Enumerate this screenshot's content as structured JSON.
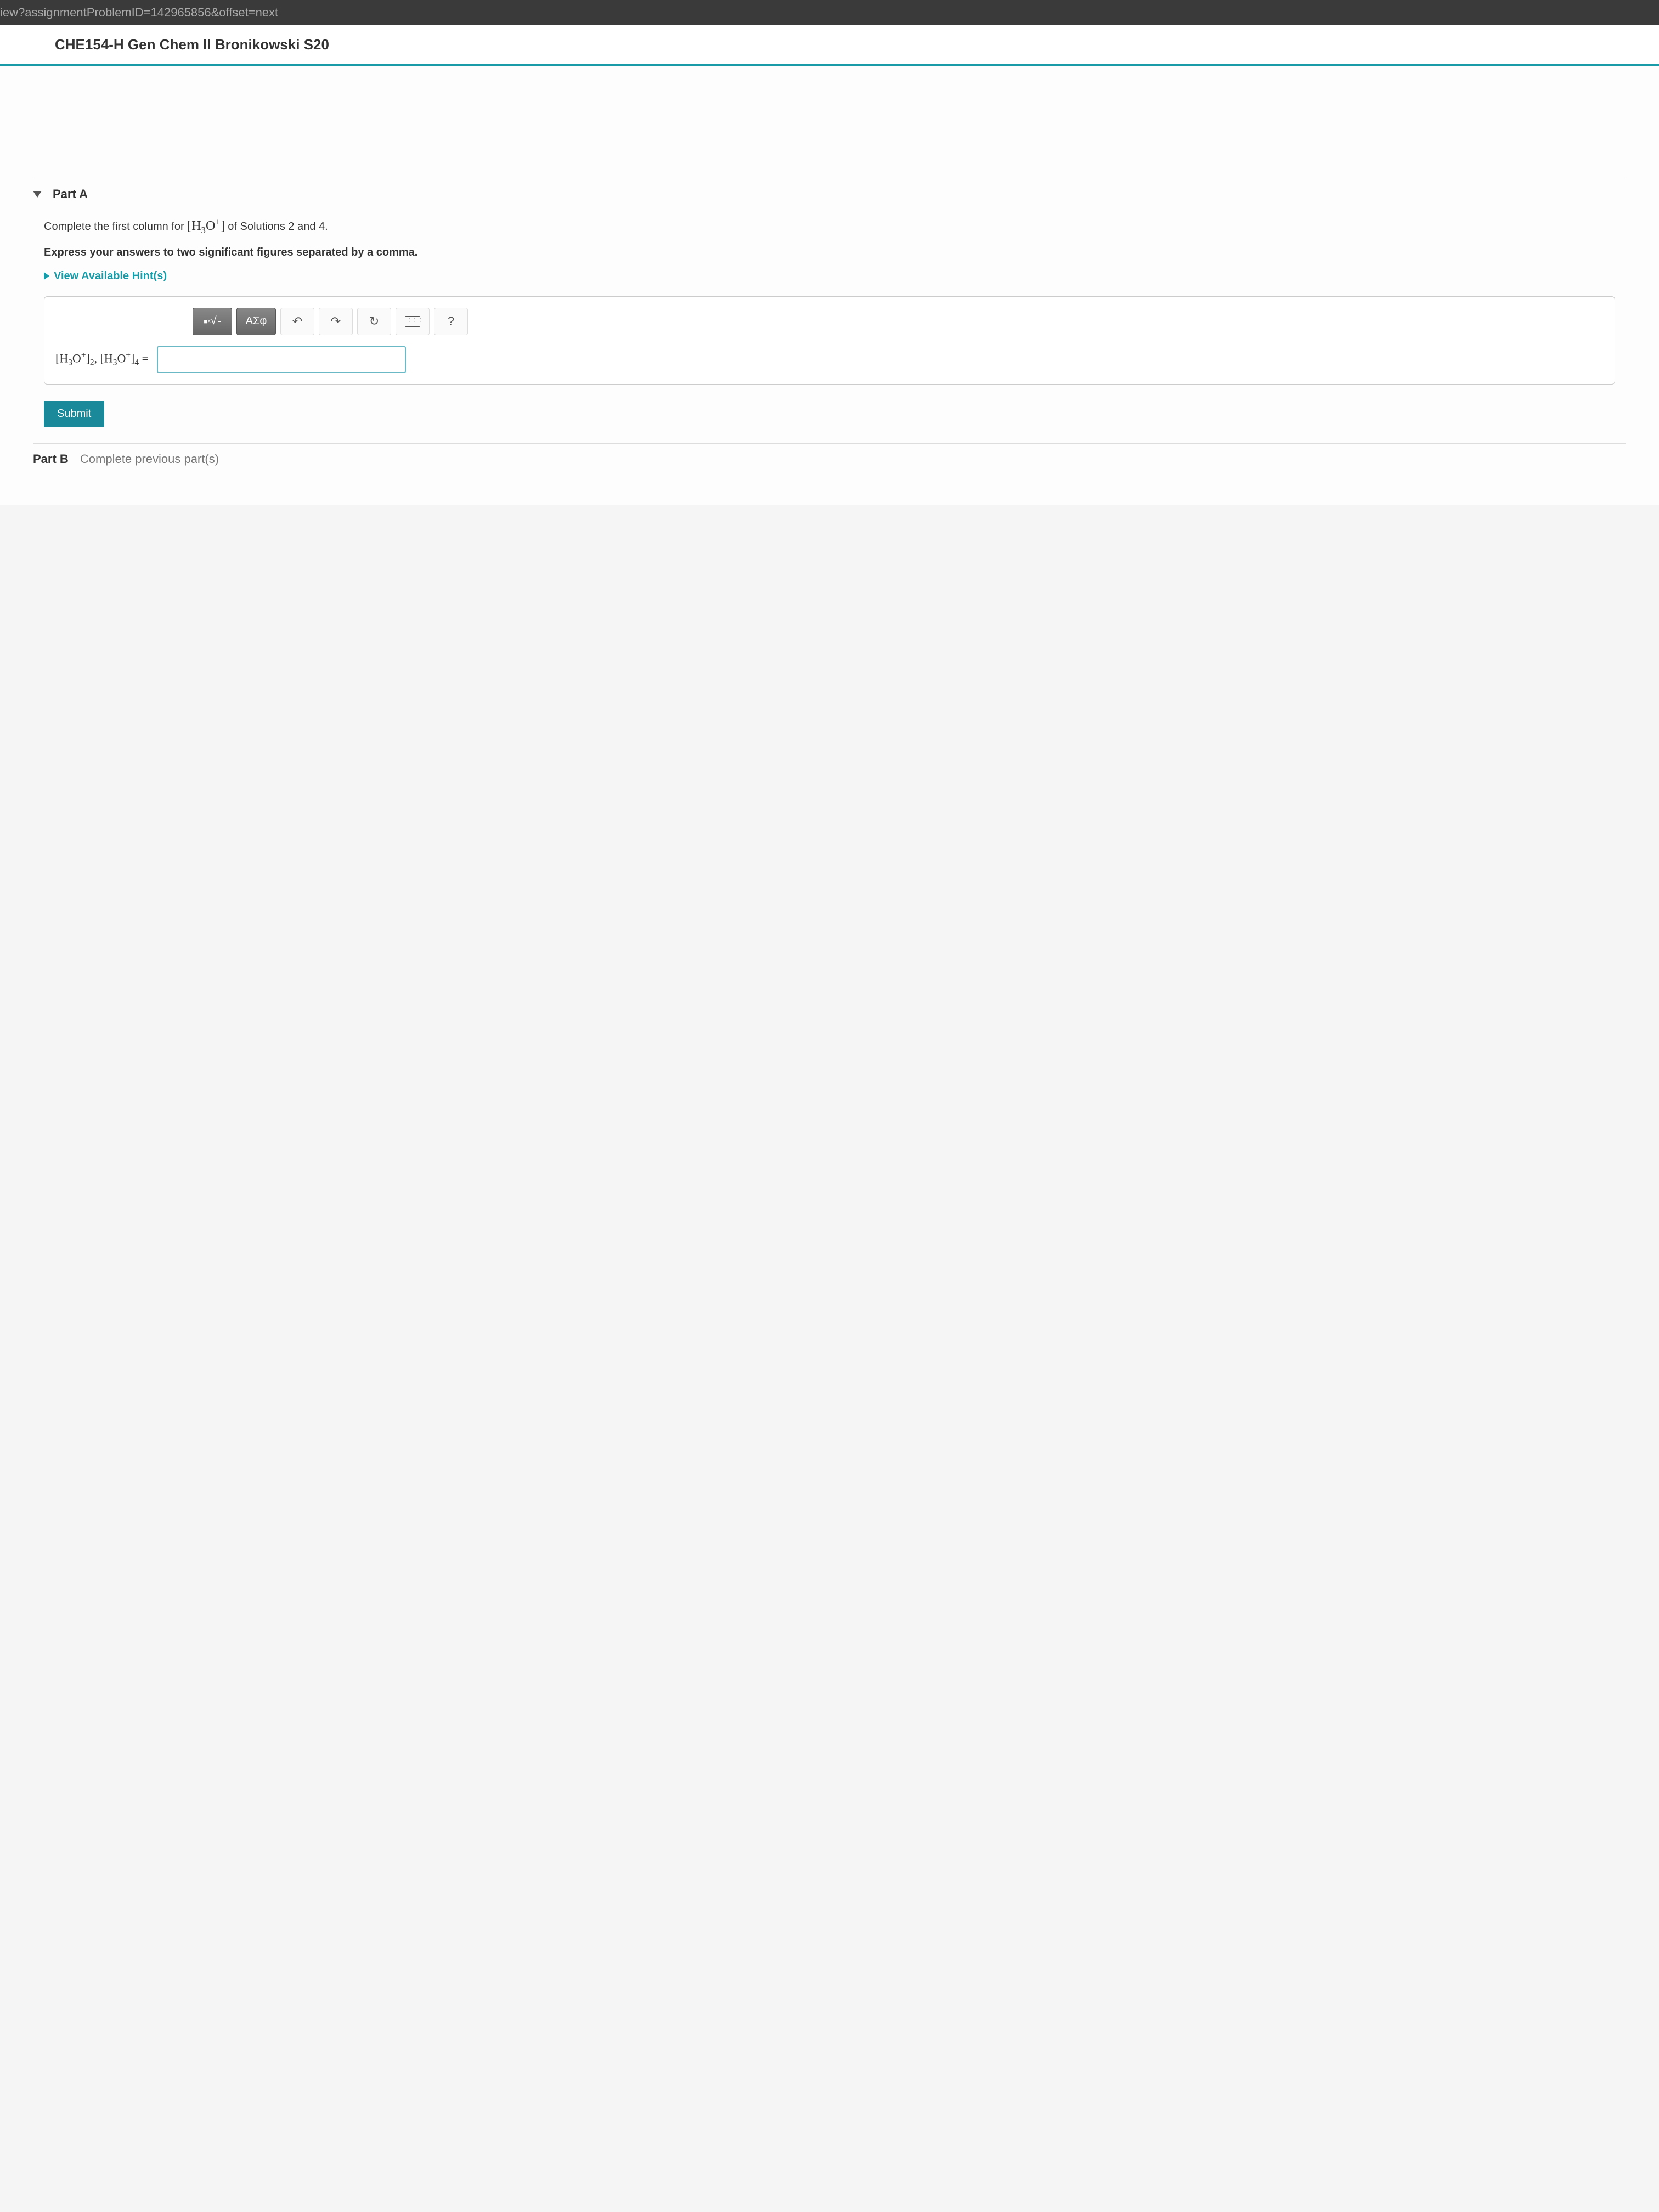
{
  "url_fragment": "iew?assignmentProblemID=142965856&offset=next",
  "course_title": "CHE154-H Gen Chem II Bronikowski S20",
  "part_a": {
    "label": "Part A",
    "question_prefix": "Complete the first column for ",
    "question_formula": "[H₃O⁺]",
    "question_suffix": " of Solutions 2 and 4.",
    "instruction": "Express your answers to two significant figures separated by a comma.",
    "hints_label": "View Available Hint(s)"
  },
  "toolbar": {
    "templates": "√",
    "greek": "ΑΣφ",
    "undo": "↶",
    "redo": "↷",
    "reset": "↻",
    "help": "?"
  },
  "answer": {
    "label_html": "[H₃O⁺]₂, [H₃O⁺]₄ =",
    "value": ""
  },
  "submit_label": "Submit",
  "part_b": {
    "label": "Part B",
    "text": "Complete previous part(s)"
  }
}
